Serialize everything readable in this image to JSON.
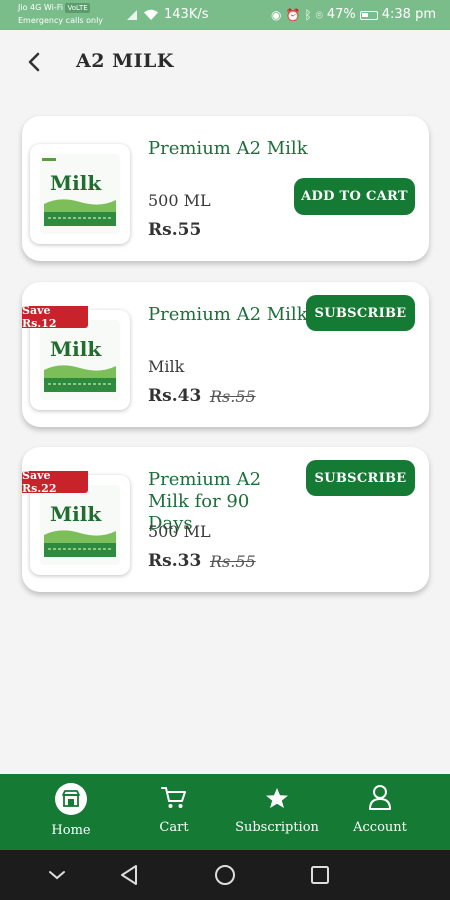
{
  "status_bar": {
    "carrier": "Jio 4G Wi-Fi",
    "carrier_tag": "VoLTE",
    "emergency": "Emergency calls only",
    "speed": "143K/s",
    "battery": "47%",
    "time": "4:38 pm"
  },
  "header": {
    "title": "A2 MILK"
  },
  "products": [
    {
      "name": "Premium A2 Milk",
      "quantity": "500 ML",
      "price": "Rs.55",
      "button": "ADD TO CART"
    },
    {
      "badge": "Save Rs.12",
      "name": "Premium A2 Milk",
      "quantity": "Milk",
      "price": "Rs.43",
      "mrp": "Rs.55",
      "button": "SUBSCRIBE"
    },
    {
      "badge": "Save Rs.22",
      "name": "Premium A2 Milk for 90 Days",
      "quantity": "500 ML",
      "price": "Rs.33",
      "mrp": "Rs.55",
      "button": "SUBSCRIBE"
    }
  ],
  "bottom_nav": {
    "items": [
      {
        "label": "Home",
        "icon": "home-store-icon"
      },
      {
        "label": "Cart",
        "icon": "cart-icon"
      },
      {
        "label": "Subscription",
        "icon": "star-icon"
      },
      {
        "label": "Account",
        "icon": "account-icon"
      }
    ]
  },
  "colors": {
    "brand_green": "#157a34",
    "title_green": "#1e6e3a",
    "badge_red": "#c8222a",
    "status_bar": "#7bbd8a"
  }
}
